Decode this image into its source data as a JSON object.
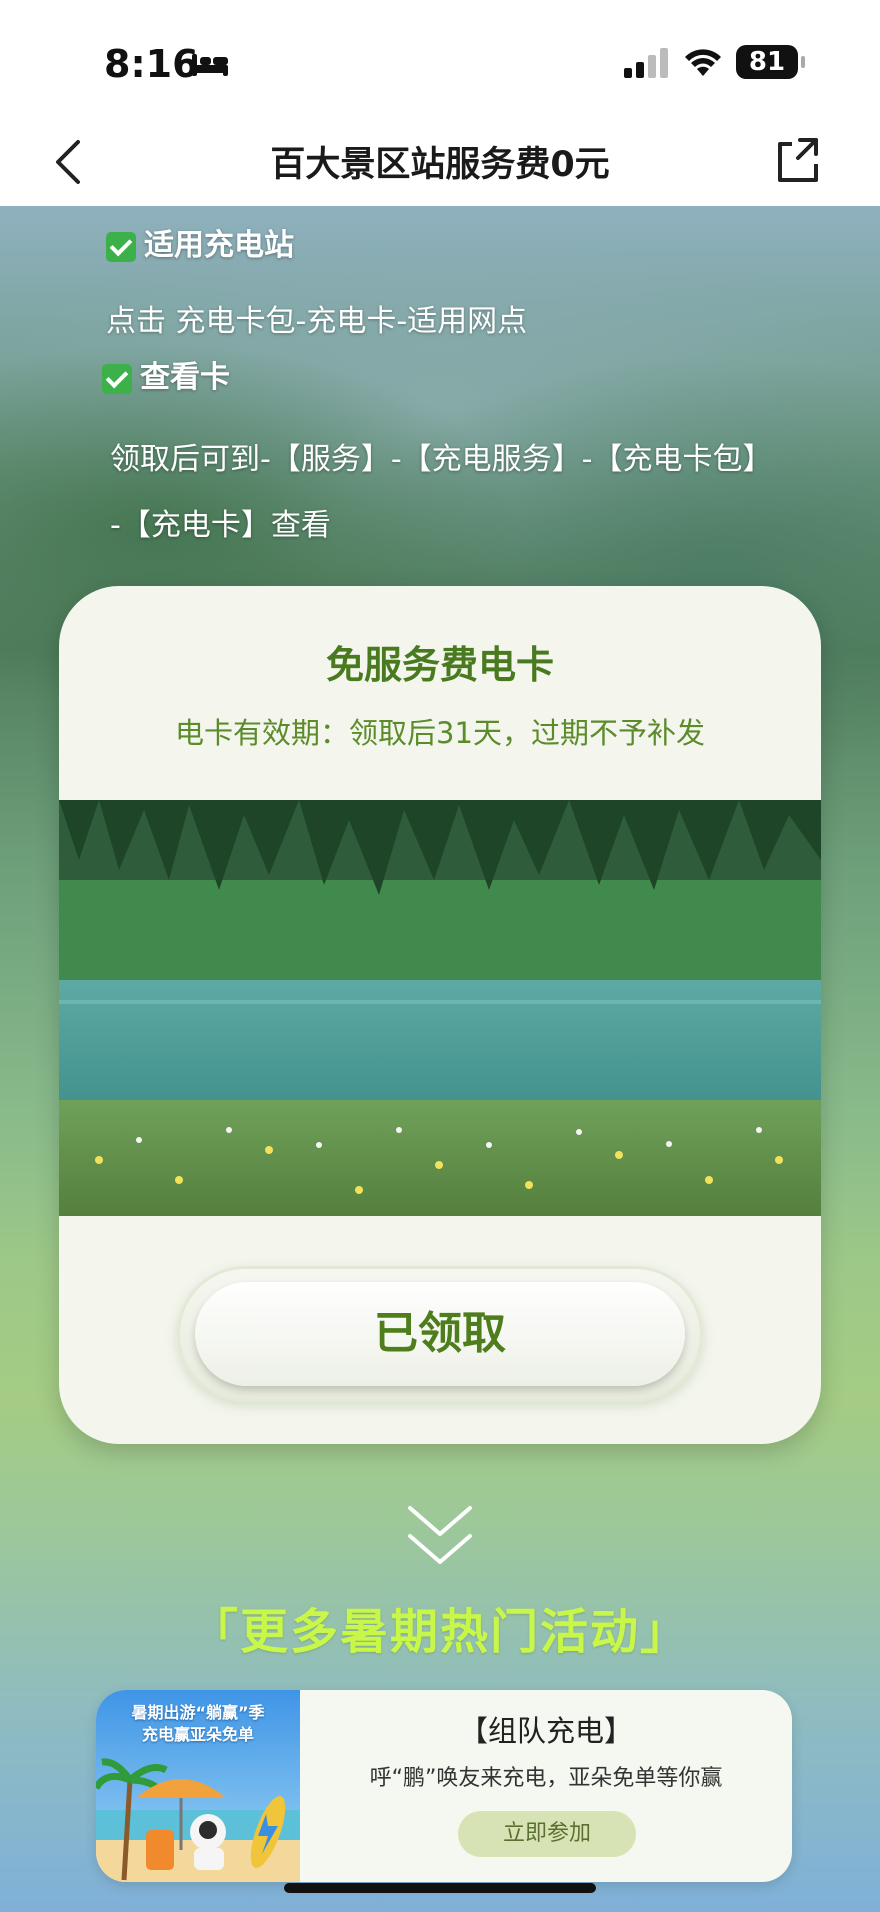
{
  "status_bar": {
    "time": "8:16",
    "battery": "81"
  },
  "nav": {
    "title": "百大景区站服务费0元"
  },
  "info": {
    "heading1": "适用充电站",
    "text1": "点击 充电卡包-充电卡-适用网点",
    "heading2": "查看卡",
    "text2a": "领取后可到-【服务】-【充电服务】-【充电卡包】",
    "text2b": "-【充电卡】查看"
  },
  "card": {
    "title": "免服务费电卡",
    "subtitle": "电卡有效期：领取后31天，过期不予补发",
    "button": "已领取"
  },
  "more_section": {
    "title": "「更多暑期热门活动」"
  },
  "promo": {
    "image_text_1": "暑期出游“躺赢”季",
    "image_text_2": "充电赢亚朵免单",
    "title": "【组队充电】",
    "description": "呼“鹏”唤友来充电，亚朵免单等你赢",
    "button": "立即参加"
  },
  "colors": {
    "card_green": "#4a7a1f",
    "more_title": "#c8f74a",
    "check_green": "#3cb14a"
  }
}
